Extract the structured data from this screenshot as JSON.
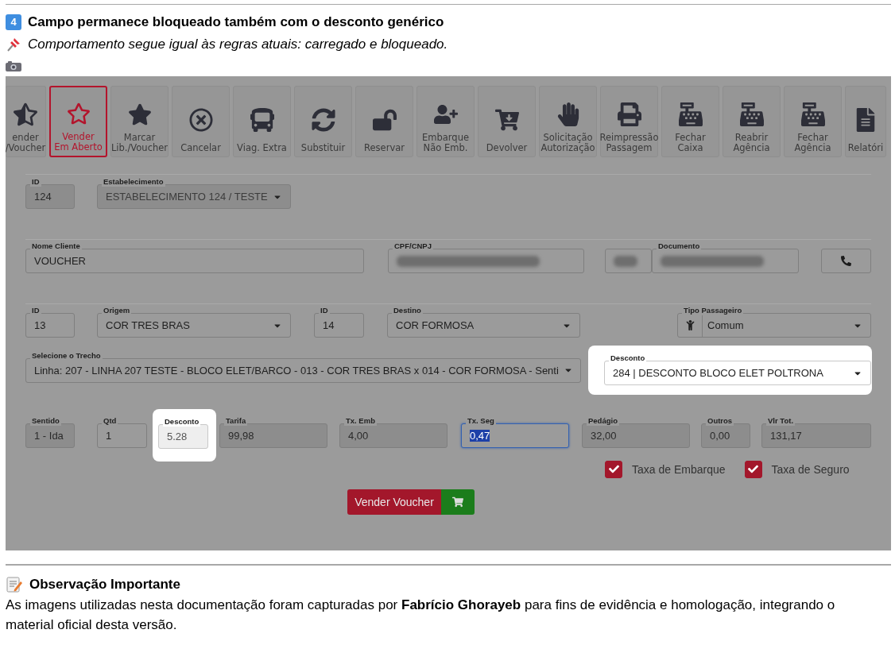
{
  "heading": {
    "badge": "4",
    "title": "Campo permanece bloqueado também com o desconto genérico",
    "note": "Comportamento segue igual às regras atuais: carregado e bloqueado."
  },
  "screenshot": {
    "toolbar": [
      {
        "lines": [
          "ender",
          "/Voucher"
        ],
        "selected": false
      },
      {
        "lines": [
          "Vender",
          "Em Aberto"
        ],
        "selected": true
      },
      {
        "lines": [
          "Marcar",
          "Lib./Voucher"
        ],
        "selected": false
      },
      {
        "lines": [
          "Cancelar"
        ],
        "selected": false
      },
      {
        "lines": [
          "Viag. Extra"
        ],
        "selected": false
      },
      {
        "lines": [
          "Substituir"
        ],
        "selected": false
      },
      {
        "lines": [
          "Reservar"
        ],
        "selected": false
      },
      {
        "lines": [
          "Embarque",
          "Não Emb."
        ],
        "selected": false
      },
      {
        "lines": [
          "Devolver"
        ],
        "selected": false
      },
      {
        "lines": [
          "Solicitação",
          "Autorização"
        ],
        "selected": false
      },
      {
        "lines": [
          "Reimpressão",
          "Passagem"
        ],
        "selected": false
      },
      {
        "lines": [
          "Fechar",
          "Caixa"
        ],
        "selected": false
      },
      {
        "lines": [
          "Reabrir",
          "Agência"
        ],
        "selected": false
      },
      {
        "lines": [
          "Fechar",
          "Agência"
        ],
        "selected": false
      },
      {
        "lines": [
          "Relatóri"
        ],
        "selected": false
      }
    ],
    "groups": [
      {
        "fields": [
          {
            "kind": "text",
            "label": "ID",
            "value": "124",
            "disabled": true,
            "highlighted": false,
            "focused": false
          },
          {
            "kind": "select",
            "label": "Estabelecimento",
            "value": "ESTABELECIMENTO 124 / TESTE",
            "disabled": true,
            "highlighted": false,
            "focused": false
          }
        ]
      },
      {
        "fields": [
          {
            "kind": "text",
            "label": "Nome Cliente",
            "value": "VOUCHER",
            "disabled": false,
            "highlighted": false,
            "focused": false
          },
          {
            "kind": "blurred",
            "label": "CPF/CNPJ",
            "disabled": false,
            "highlighted": false,
            "focused": false
          },
          {
            "kind": "blurred",
            "disabled": false,
            "highlighted": false,
            "focused": false
          },
          {
            "kind": "blurred",
            "label": "Documento",
            "disabled": false,
            "highlighted": false,
            "focused": false
          },
          {
            "kind": "phone"
          }
        ]
      },
      {
        "fields": [
          {
            "kind": "text",
            "label": "ID",
            "value": "13",
            "disabled": false,
            "highlighted": false,
            "focused": false
          },
          {
            "kind": "select",
            "label": "Origem",
            "value": "COR TRES BRAS",
            "disabled": false,
            "highlighted": false,
            "focused": false
          },
          {
            "kind": "text",
            "label": "ID",
            "value": "14",
            "disabled": false,
            "highlighted": false,
            "focused": false
          },
          {
            "kind": "select",
            "label": "Destino",
            "value": "COR FORMOSA",
            "disabled": false,
            "highlighted": false,
            "focused": false
          },
          {
            "kind": "addon-select",
            "label": "Tipo Passageiro",
            "value": "Comum",
            "disabled": false,
            "highlighted": false,
            "focused": false
          }
        ]
      },
      {
        "fields": [
          {
            "kind": "select",
            "label": "Selecione o Trecho",
            "value": "Linha: 207 - LINHA 207 TESTE - BLOCO ELET/BARCO - 013 - COR TRES BRAS x 014 - COR FORMOSA - Senti",
            "disabled": false,
            "highlighted": false,
            "focused": false
          },
          {
            "kind": "select",
            "label": "Desconto",
            "value": "284 | DESCONTO BLOCO ELET POLTRONA",
            "disabled": false,
            "highlighted": true,
            "focused": false
          }
        ]
      },
      {
        "fields": [
          {
            "kind": "text",
            "label": "Sentido",
            "value": "1 - Ida",
            "disabled": true,
            "highlighted": false,
            "focused": false
          },
          {
            "kind": "text",
            "label": "Qtd",
            "value": "1",
            "disabled": false,
            "highlighted": false,
            "focused": false
          },
          {
            "kind": "text",
            "label": "Desconto",
            "value": "5.28",
            "disabled": true,
            "highlighted": true,
            "focused": false
          },
          {
            "kind": "text",
            "label": "Tarifa",
            "value": "99,98",
            "disabled": true,
            "highlighted": false,
            "focused": false
          },
          {
            "kind": "text",
            "label": "Tx. Emb",
            "value": "4,00",
            "disabled": true,
            "highlighted": false,
            "focused": false
          },
          {
            "kind": "text",
            "label": "Tx. Seg",
            "value": "0,47",
            "disabled": false,
            "highlighted": false,
            "focused": true
          },
          {
            "kind": "text",
            "label": "Pedágio",
            "value": "32,00",
            "disabled": true,
            "highlighted": false,
            "focused": false
          },
          {
            "kind": "text",
            "label": "Outros",
            "value": "0,00",
            "disabled": true,
            "highlighted": false,
            "focused": false
          },
          {
            "kind": "text",
            "label": "Vlr Tot.",
            "value": "131,17",
            "disabled": true,
            "highlighted": false,
            "focused": false
          }
        ]
      }
    ],
    "checkboxes": [
      {
        "label": "Taxa de Embarque",
        "checked": true
      },
      {
        "label": "Taxa de Seguro",
        "checked": true
      }
    ],
    "submit": {
      "label": "Vender Voucher"
    }
  },
  "footer": {
    "title": "Observação Importante",
    "text": "As imagens utilizadas nesta documentação foram capturadas por **Fabrício Ghorayeb** para fins de evidência e homologação, integrando o material oficial desta versão."
  }
}
